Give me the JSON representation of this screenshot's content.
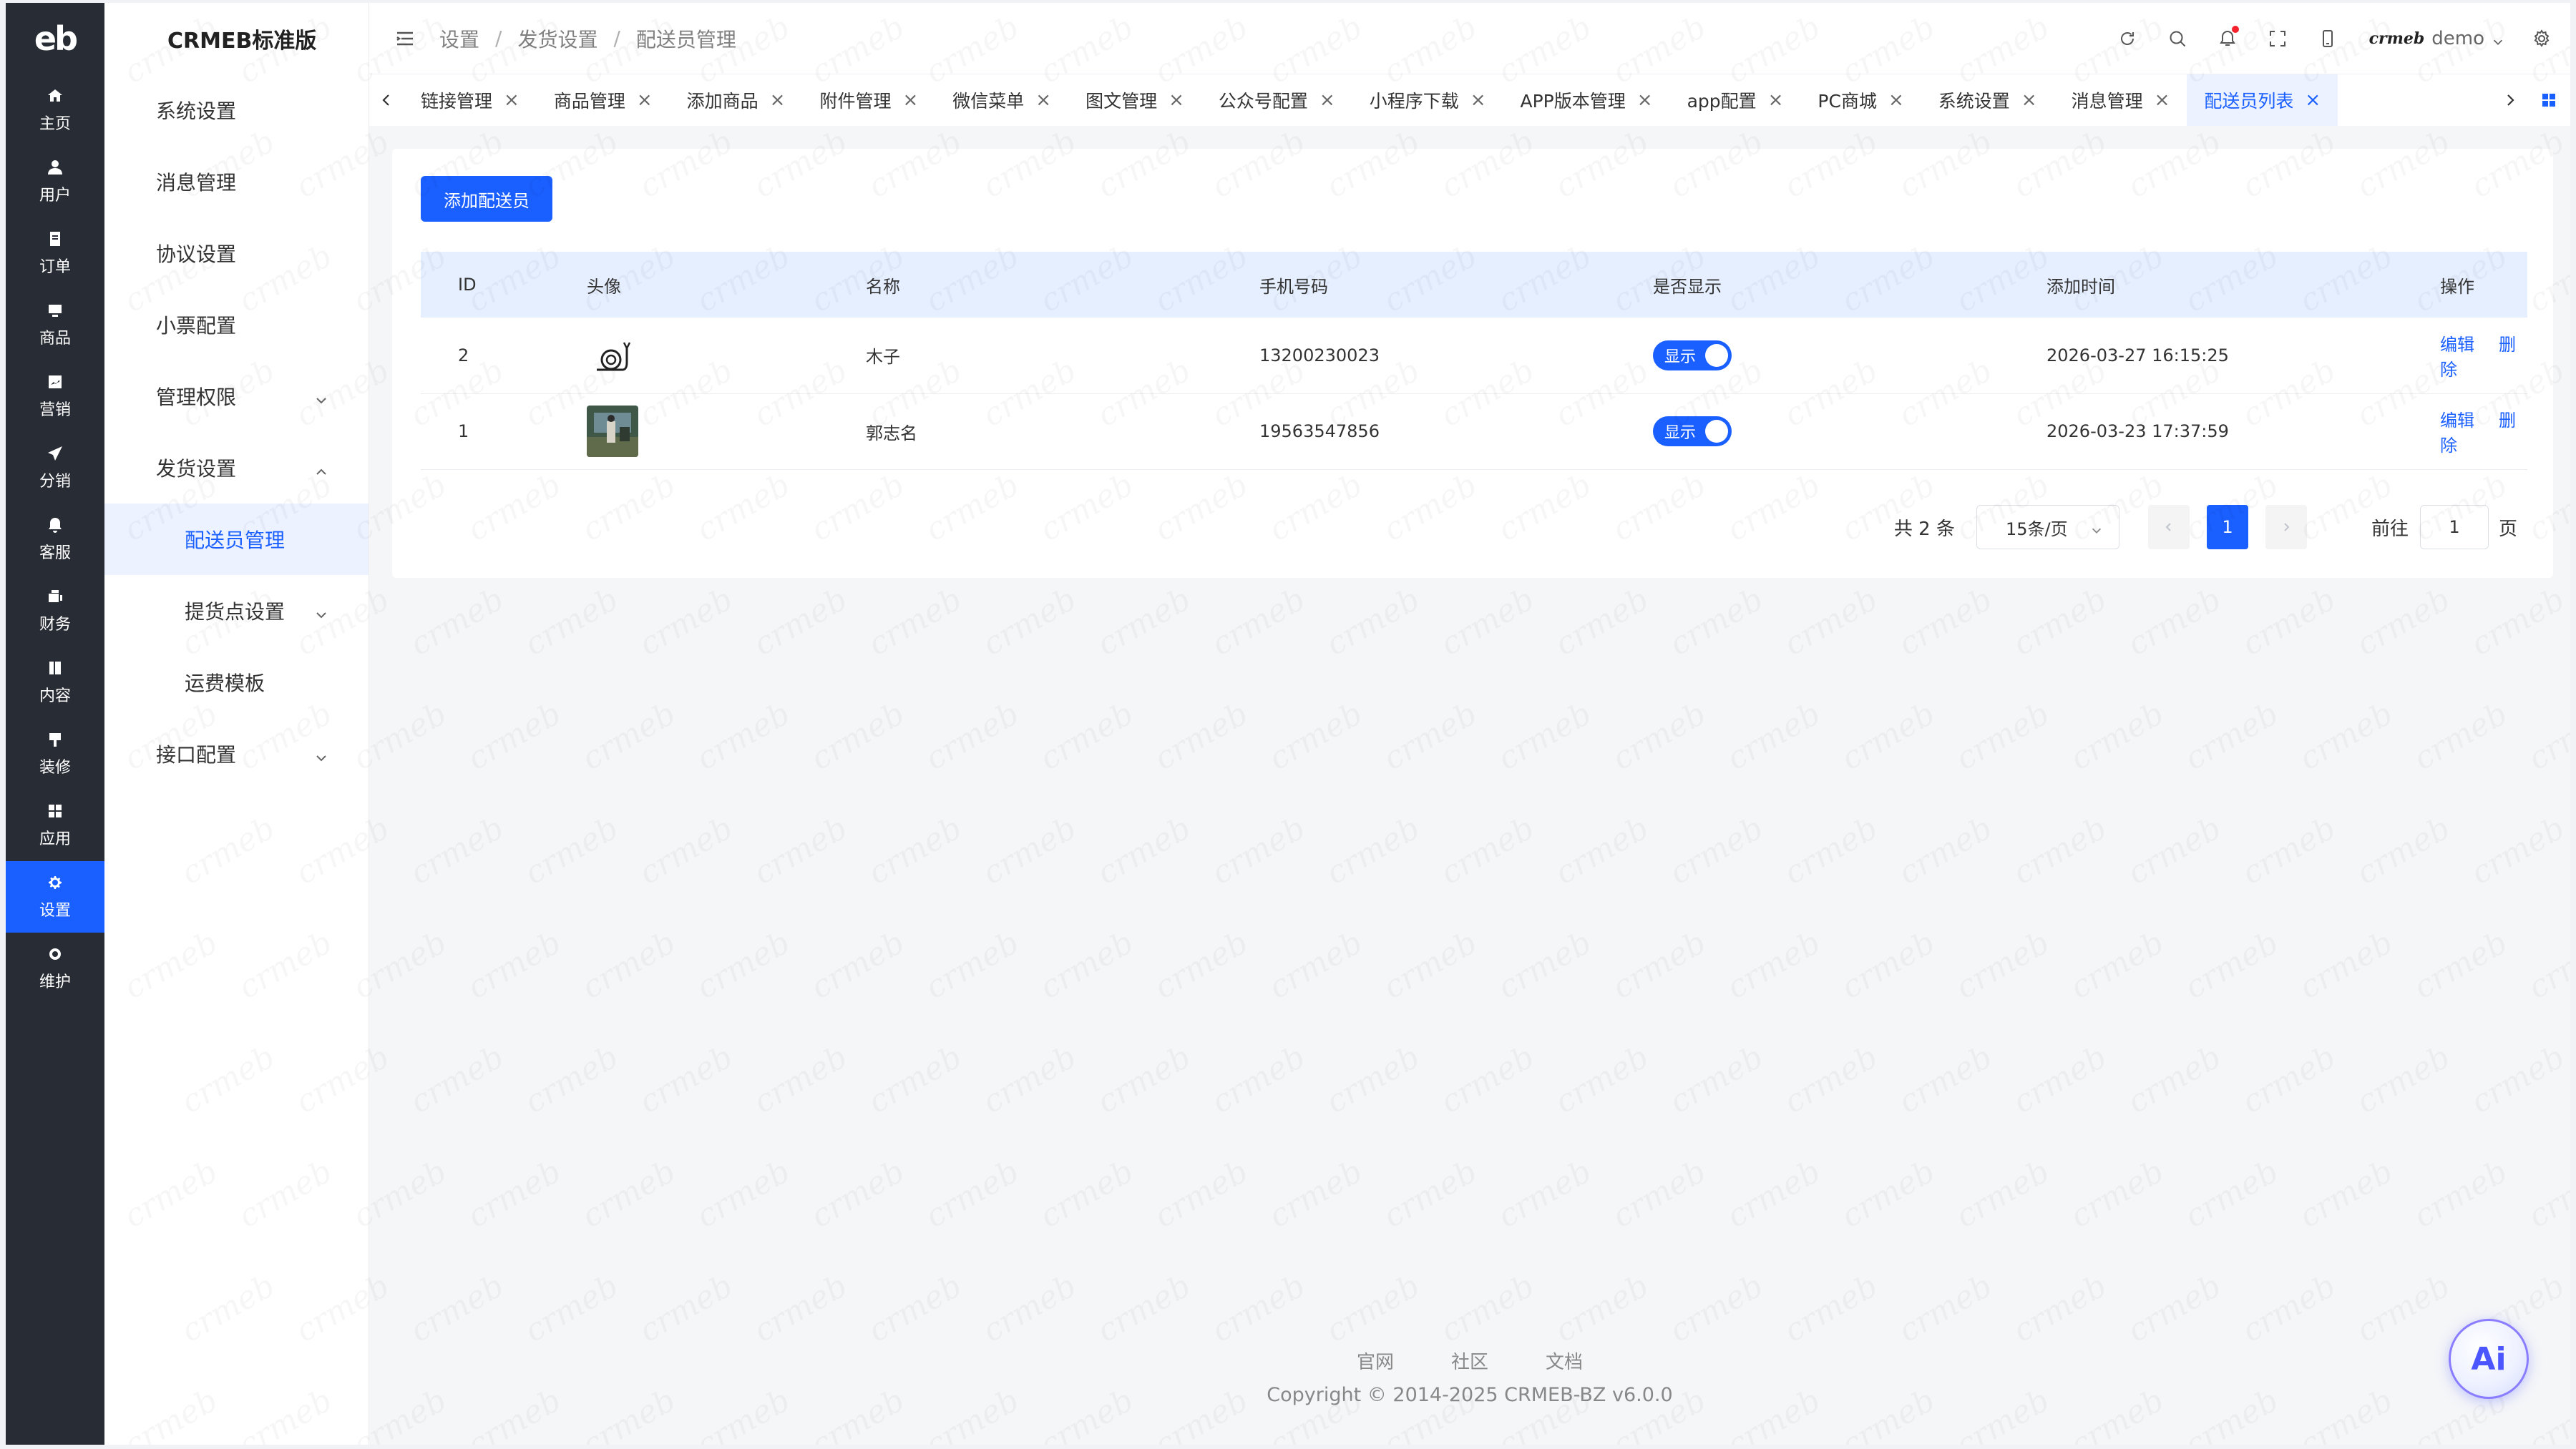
{
  "rail": {
    "logo": "eb",
    "items": [
      {
        "label": "主页",
        "icon": "home-icon"
      },
      {
        "label": "用户",
        "icon": "user-icon"
      },
      {
        "label": "订单",
        "icon": "order-icon"
      },
      {
        "label": "商品",
        "icon": "product-icon"
      },
      {
        "label": "营销",
        "icon": "marketing-icon"
      },
      {
        "label": "分销",
        "icon": "distribution-icon"
      },
      {
        "label": "客服",
        "icon": "bell-icon"
      },
      {
        "label": "财务",
        "icon": "finance-icon"
      },
      {
        "label": "内容",
        "icon": "content-icon"
      },
      {
        "label": "装修",
        "icon": "decorate-icon"
      },
      {
        "label": "应用",
        "icon": "apps-icon"
      },
      {
        "label": "设置",
        "icon": "gear-icon",
        "active": true
      },
      {
        "label": "维护",
        "icon": "maintain-icon"
      }
    ]
  },
  "submenu": {
    "title": "CRMEB标准版",
    "items": [
      {
        "label": "系统设置"
      },
      {
        "label": "消息管理"
      },
      {
        "label": "协议设置"
      },
      {
        "label": "小票配置"
      },
      {
        "label": "管理权限",
        "chevron": "down"
      },
      {
        "label": "发货设置",
        "chevron": "up"
      },
      {
        "label": "配送员管理",
        "child": true,
        "active": true
      },
      {
        "label": "提货点设置",
        "child": true,
        "chevron": "down"
      },
      {
        "label": "运费模板",
        "child": true
      },
      {
        "label": "接口配置",
        "chevron": "down"
      }
    ]
  },
  "header": {
    "breadcrumb": [
      "设置",
      "发货设置",
      "配送员管理"
    ],
    "user_logo": "crmeb",
    "username": "demo"
  },
  "tabs": [
    {
      "label": "链接管理"
    },
    {
      "label": "商品管理"
    },
    {
      "label": "添加商品"
    },
    {
      "label": "附件管理"
    },
    {
      "label": "微信菜单"
    },
    {
      "label": "图文管理"
    },
    {
      "label": "公众号配置"
    },
    {
      "label": "小程序下载"
    },
    {
      "label": "APP版本管理"
    },
    {
      "label": "app配置"
    },
    {
      "label": "PC商城"
    },
    {
      "label": "系统设置"
    },
    {
      "label": "消息管理"
    },
    {
      "label": "配送员列表",
      "active": true
    }
  ],
  "main": {
    "add_button": "添加配送员",
    "columns": [
      "ID",
      "头像",
      "名称",
      "手机号码",
      "是否显示",
      "添加时间",
      "操作"
    ],
    "rows": [
      {
        "id": "2",
        "avatar": "snail-avatar",
        "name": "木子",
        "phone": "13200230023",
        "show": "显示",
        "time": "2026-03-27 16:15:25",
        "edit": "编辑",
        "delete": "删除"
      },
      {
        "id": "1",
        "avatar": "photo-avatar",
        "name": "郭志名",
        "phone": "19563547856",
        "show": "显示",
        "time": "2026-03-23 17:37:59",
        "edit": "编辑",
        "delete": "删除"
      }
    ],
    "pagination": {
      "total_text": "共 2 条",
      "page_size": "15条/页",
      "current_page": "1",
      "goto_label": "前往",
      "goto_value": "1",
      "goto_suffix": "页"
    }
  },
  "footer": {
    "links": [
      "官网",
      "社区",
      "文档"
    ],
    "copyright": "Copyright © 2014-2025 CRMEB-BZ v6.0.0"
  },
  "ai_button": "Ai",
  "watermark_text": "crmeb",
  "colors": {
    "accent": "#1a5fff",
    "rail": "#282c34",
    "header_row": "#e6efff"
  }
}
